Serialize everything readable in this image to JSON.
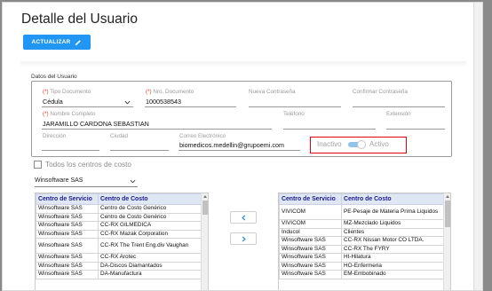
{
  "dialog": {
    "title": "Detalle del Usuario",
    "update_button": "ACTUALIZAR"
  },
  "user_data": {
    "legend": "Datos del Usuario",
    "required_mark": "(*)",
    "tipo_documento": {
      "label": "Tipo Documento",
      "value": "Cédula"
    },
    "nro_documento": {
      "label": "Nro. Documento",
      "value": "1000538543"
    },
    "nueva_contrasena": {
      "label": "Nueva Contraseña",
      "value": ""
    },
    "confirmar_contrasena": {
      "label": "Confirmar Contraseña",
      "value": ""
    },
    "nombre_completo": {
      "label": "Nombre Completo",
      "value": "JARAMILLO CARDONA SEBASTIAN"
    },
    "telefono": {
      "label": "Teléfono",
      "value": ""
    },
    "extension": {
      "label": "Extensión",
      "value": ""
    },
    "direccion": {
      "label": "Dirección",
      "value": ""
    },
    "ciudad": {
      "label": "Ciudad",
      "value": ""
    },
    "correo": {
      "label": "Correo Electrónico",
      "value": "biomedicos.medellin@grupoemi.com"
    },
    "status": {
      "off_label": "Inactivo",
      "on_label": "Activo",
      "active": true
    }
  },
  "cost_centers": {
    "all_checkbox_label": "Todos los centros de costo",
    "all_checked": false,
    "company_select": "Winsoftware SAS",
    "left_table": {
      "headers": [
        "Centro de Servicio",
        "Centro de Costo"
      ],
      "rows": [
        [
          "Winsoftware SAS",
          "Centro de Costo Genérico"
        ],
        [
          "Winsoftware SAS",
          "Centro de Costo Genérico"
        ],
        [
          "Winsoftware SAS",
          "CC-RX GILMEDICA"
        ],
        [
          "Winsoftware SAS",
          "CC-RX Mazak Corporation"
        ],
        [
          "Winsoftware SAS",
          "CC-RX The Trent Eng.div Vaughan"
        ],
        [
          "Winsoftware SAS",
          "CC-RX Arotec"
        ],
        [
          "Winsoftware SAS",
          "DA-Discos Diamantados"
        ],
        [
          "Winsoftware SAS",
          "DA-Manufactura"
        ]
      ]
    },
    "right_table": {
      "headers": [
        "Centro de Servicio",
        "Centro de Costo"
      ],
      "rows": [
        [
          "VIVICOM",
          "PE-Pesaje de Materia Prima Liquidos"
        ],
        [
          "VIVICOM",
          "MZ-Mezclado Liquidos"
        ],
        [
          "Inducol",
          "Clientes"
        ],
        [
          "Winsoftware SAS",
          "CC-RX Nissan Motor CO LTDA."
        ],
        [
          "Winsoftware SAS",
          "CC-RX The FYRY"
        ],
        [
          "Winsoftware SAS",
          "HI-Hilatura"
        ],
        [
          "Winsoftware SAS",
          "HO-Enfermeria"
        ],
        [
          "Winsoftware SAS",
          "EM-Embobinado"
        ]
      ]
    }
  },
  "colors": {
    "primary": "#2196f3",
    "required": "#e53935",
    "highlight_border": "#e0000e",
    "table_header_bg": "#dfe7f5",
    "table_header_text": "#1a1a8c"
  },
  "icons": {
    "update": "pencil-icon",
    "move_left": "chevron-left-icon",
    "move_right": "chevron-right-icon",
    "select": "chevron-down-icon"
  }
}
